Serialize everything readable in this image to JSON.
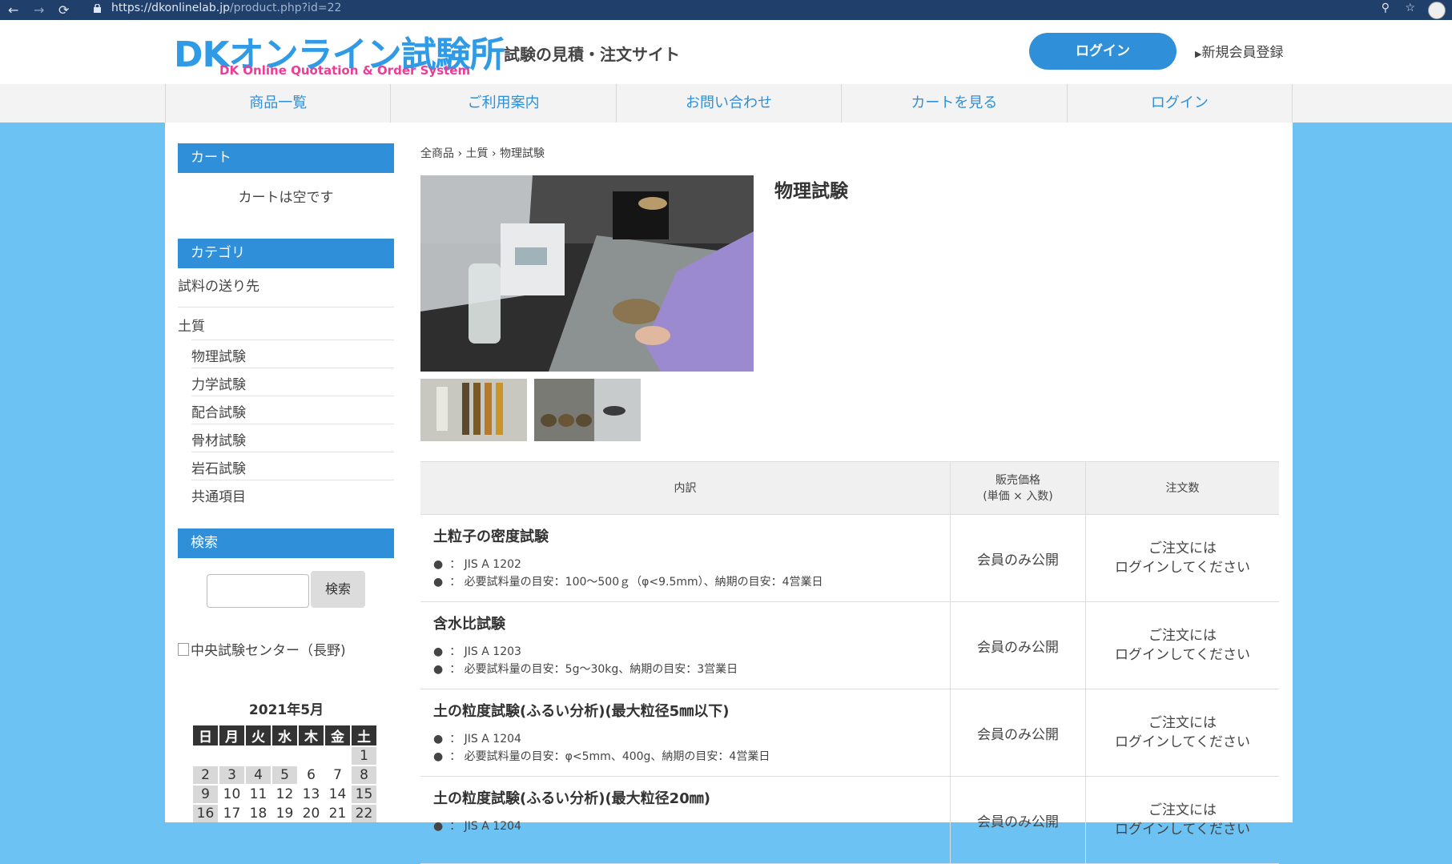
{
  "browser": {
    "url_host": "https://dkonlinelab.jp",
    "url_path": "/product.php?id=22"
  },
  "header": {
    "logo": "DKオンライン試験所",
    "logo_sub": "DK Online Quotation & Order System",
    "tagline": "試験の見積・注文サイト",
    "login_button": "ログイン",
    "register_link": "新規会員登録"
  },
  "gnav": [
    "商品一覧",
    "ご利用案内",
    "お問い合わせ",
    "カートを見る",
    "ログイン"
  ],
  "sidebar": {
    "cart_heading": "カート",
    "cart_empty": "カートは空です",
    "category_heading": "カテゴリ",
    "categories": {
      "top": "試料の送り先",
      "group": "土質",
      "sub": [
        "物理試験",
        "力学試験",
        "配合試験",
        "骨材試験",
        "岩石試験",
        "共通項目"
      ]
    },
    "search_heading": "検索",
    "search_button": "検索",
    "banner_alt": "中央試験センター（長野)",
    "calendar": {
      "title": "2021年5月",
      "weekdays": [
        "日",
        "月",
        "火",
        "水",
        "木",
        "金",
        "土"
      ],
      "rows": [
        [
          "",
          "",
          "",
          "",
          "",
          "",
          "1"
        ],
        [
          "2",
          "3",
          "4",
          "5",
          "6",
          "7",
          "8"
        ],
        [
          "9",
          "10",
          "11",
          "12",
          "13",
          "14",
          "15"
        ],
        [
          "16",
          "17",
          "18",
          "19",
          "20",
          "21",
          "22"
        ]
      ],
      "holidays": [
        "1",
        "2",
        "3",
        "4",
        "5",
        "8",
        "9",
        "15",
        "16",
        "22"
      ]
    }
  },
  "main": {
    "breadcrumb": [
      "全商品",
      "土質",
      "物理試験"
    ],
    "title": "物理試験",
    "table_headers": {
      "desc": "内訳",
      "price_line1": "販売価格",
      "price_line2": "(単価 × 入数)",
      "qty": "注文数"
    },
    "items": [
      {
        "name": "土粒子の密度試験",
        "spec1": "JIS A 1202",
        "spec2": "必要試料量の目安：100～500ｇ（φ<9.5mm）、納期の目安：4営業日",
        "price": "会員のみ公開",
        "qty1": "ご注文には",
        "qty2": "ログインしてください"
      },
      {
        "name": "含水比試験",
        "spec1": "JIS A 1203",
        "spec2": "必要試料量の目安：5g～30kg、納期の目安：3営業日",
        "price": "会員のみ公開",
        "qty1": "ご注文には",
        "qty2": "ログインしてください"
      },
      {
        "name": "土の粒度試験(ふるい分析)(最大粒径5㎜以下)",
        "spec1": "JIS A 1204",
        "spec2": "必要試料量の目安：φ<5mm、400g、納期の目安：4営業日",
        "price": "会員のみ公開",
        "qty1": "ご注文には",
        "qty2": "ログインしてください"
      },
      {
        "name": "土の粒度試験(ふるい分析)(最大粒径20㎜)",
        "spec1": "JIS A 1204",
        "spec2": "",
        "price": "会員のみ公開",
        "qty1": "ご注文には",
        "qty2": "ログインしてください"
      }
    ],
    "spec_label": "："
  }
}
